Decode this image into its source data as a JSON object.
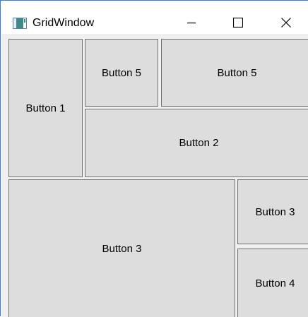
{
  "window": {
    "title": "GridWindow",
    "accent_color": "#3a7bd5",
    "icon": "app-window-icon",
    "controls": {
      "minimize_icon": "minimize-icon",
      "maximize_icon": "maximize-icon",
      "close_icon": "close-icon"
    }
  },
  "grid": {
    "button_color": "#dddddd",
    "border_color": "#707070",
    "buttons": {
      "button1": "Button 1",
      "button5_left": "Button 5",
      "button5_right": "Button 5",
      "button2": "Button 2",
      "button3_large": "Button 3",
      "button3_small": "Button 3",
      "button4": "Button 4"
    }
  }
}
